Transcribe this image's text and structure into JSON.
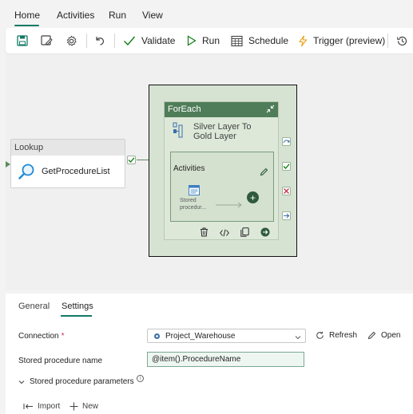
{
  "tabs": [
    "Home",
    "Activities",
    "Run",
    "View"
  ],
  "toolbar": {
    "validate_label": "Validate",
    "run_label": "Run",
    "schedule_label": "Schedule",
    "trigger_label": "Trigger (preview)"
  },
  "canvas": {
    "lookup": {
      "header": "Lookup",
      "name": "GetProcedureList"
    },
    "foreach": {
      "header": "ForEach",
      "subtitle": "Silver Layer To Gold Layer",
      "inner_title": "Activities",
      "inner_activity": "Stored procedur..."
    }
  },
  "panel": {
    "tabs": [
      "General",
      "Settings"
    ],
    "active_tab": "Settings",
    "connection_label": "Connection",
    "required_mark": "*",
    "connection_value": "Project_Warehouse",
    "refresh_label": "Refresh",
    "open_label": "Open",
    "sp_name_label": "Stored procedure name",
    "sp_name_value": "@item().ProcedureName",
    "sp_params_label": "Stored procedure parameters",
    "import_label": "Import",
    "new_label": "New"
  },
  "colors": {
    "accent": "#117865",
    "node_header": "#4f7d59",
    "success": "#107c10",
    "fail": "#c4314b"
  }
}
